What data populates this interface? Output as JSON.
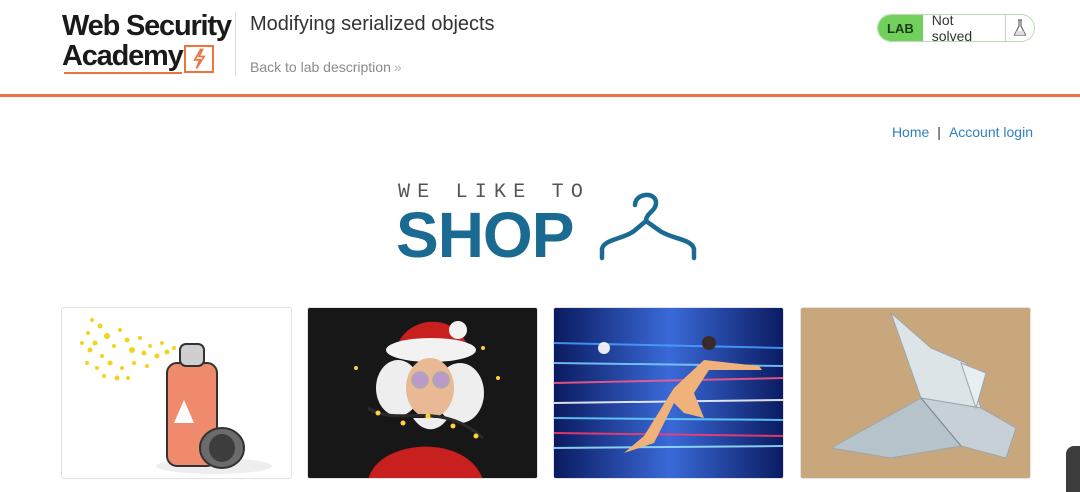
{
  "header": {
    "logo_line1": "Web Security",
    "logo_line2": "Academy",
    "lab_title": "Modifying serialized objects",
    "back_link": "Back to lab description",
    "back_chevron": "»",
    "status_badge": "LAB",
    "status_text": "Not solved",
    "status_color": "#70d05b",
    "accent_color": "#f0733e"
  },
  "nav": {
    "home": "Home",
    "separator": "|",
    "account_login": "Account login",
    "link_color": "#2f7fc4"
  },
  "banner": {
    "line1": "WE LIKE TO",
    "line2": "SHOP",
    "color": "#1a6a91"
  },
  "products": [
    {
      "name": "spray-can"
    },
    {
      "name": "santa-lights"
    },
    {
      "name": "flying-hero"
    },
    {
      "name": "origami-bird"
    }
  ]
}
